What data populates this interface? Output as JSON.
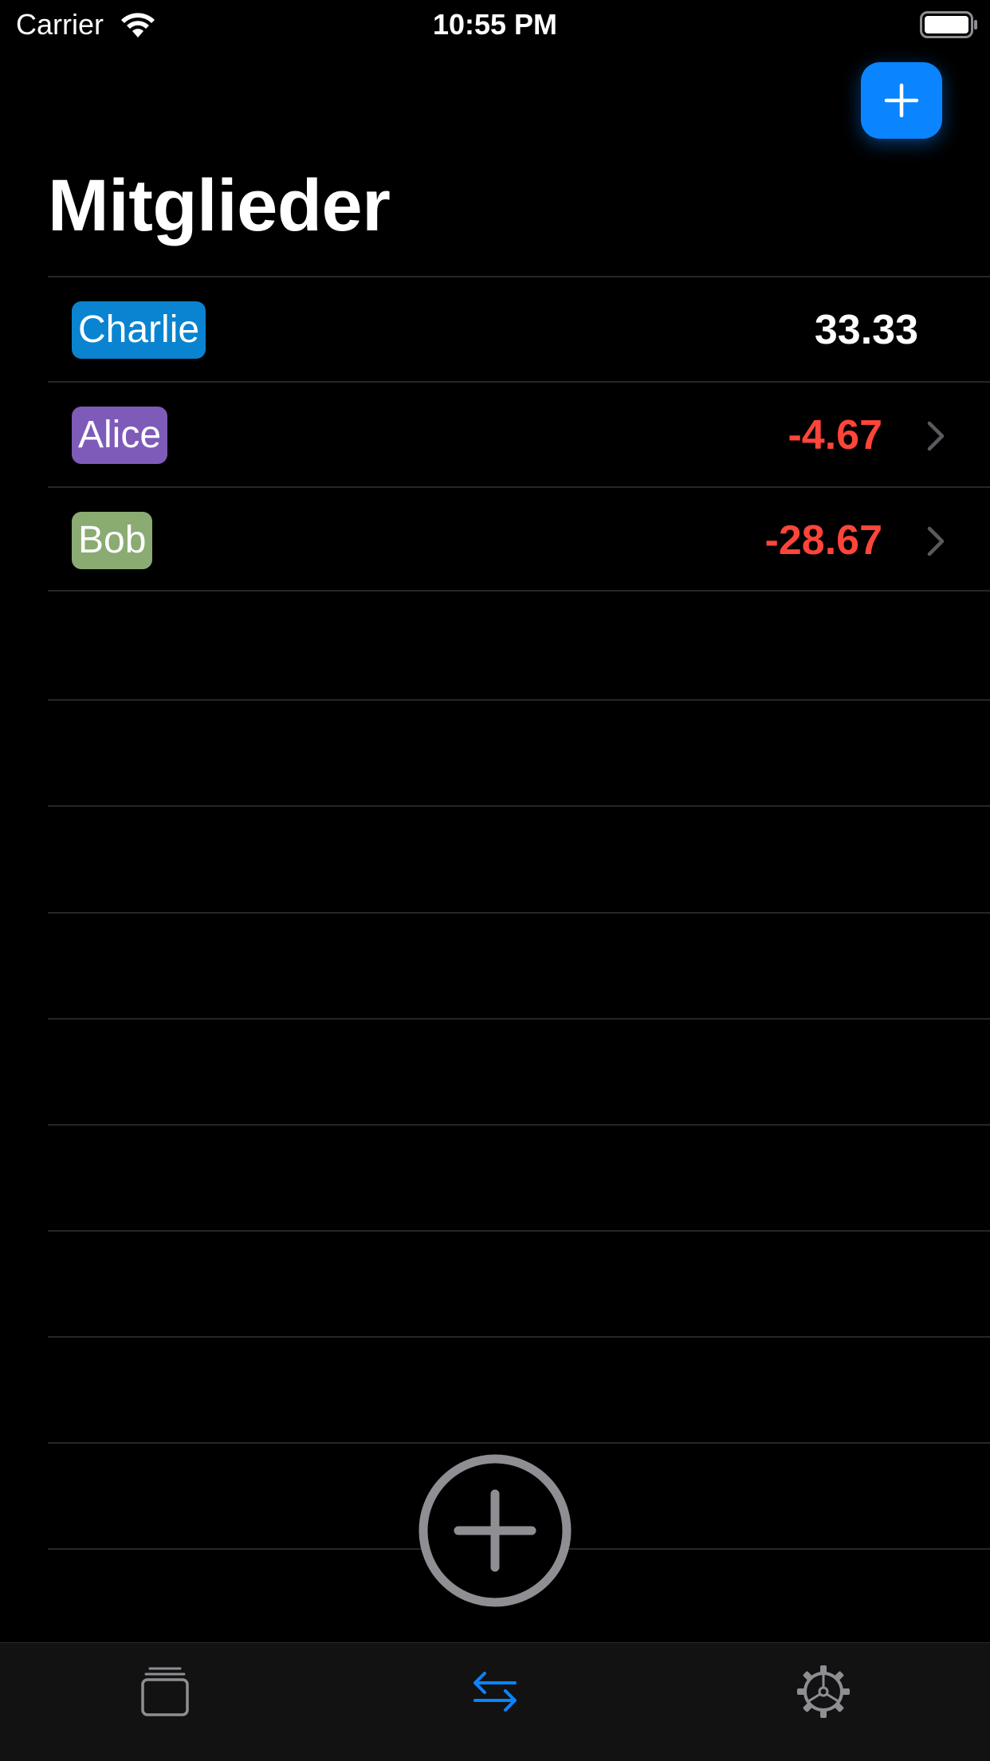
{
  "status_bar": {
    "carrier": "Carrier",
    "time": "10:55 PM"
  },
  "header": {
    "title": "Mitglieder",
    "add_icon": "plus-icon"
  },
  "members": [
    {
      "name": "Charlie",
      "chip_color": "#0a84d0",
      "amount": "33.33",
      "amount_color": "#ffffff",
      "has_chevron": false
    },
    {
      "name": "Alice",
      "chip_color": "#7e5bb8",
      "amount": "-4.67",
      "amount_color": "#ff453a",
      "has_chevron": true
    },
    {
      "name": "Bob",
      "chip_color": "#8aab72",
      "amount": "-28.67",
      "amount_color": "#ff453a",
      "has_chevron": true
    }
  ],
  "floating_add_icon": "circle-plus-icon",
  "tabs": [
    {
      "icon": "card-stack-icon",
      "selected": false
    },
    {
      "icon": "transfer-arrows-icon",
      "selected": true
    },
    {
      "icon": "gear-icon",
      "selected": false
    }
  ],
  "colors": {
    "accent": "#0a84ff",
    "negative": "#ff453a",
    "background": "#000000",
    "separator": "#262626",
    "tabbar": "#121212",
    "inactive_icon": "#8e8e93"
  }
}
